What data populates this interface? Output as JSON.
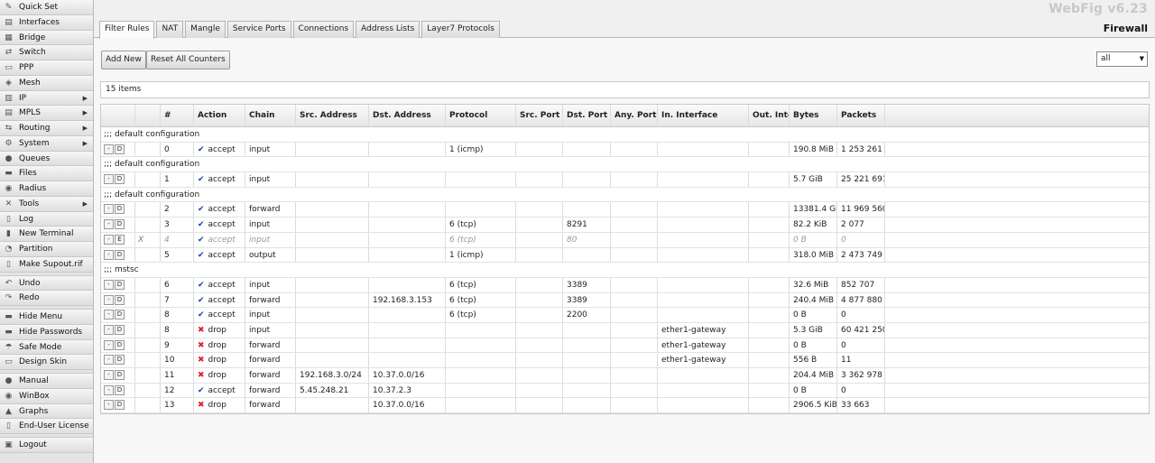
{
  "brand": "WebFig v6.23",
  "page_title": "Firewall",
  "sidebar": {
    "items": [
      {
        "label": "Quick Set",
        "icon": "wand-icon",
        "glyph": "✎",
        "arrow": false
      },
      {
        "label": "Interfaces",
        "icon": "interfaces-icon",
        "glyph": "▤",
        "arrow": false
      },
      {
        "label": "Bridge",
        "icon": "bridge-icon",
        "glyph": "▦",
        "arrow": false
      },
      {
        "label": "Switch",
        "icon": "switch-icon",
        "glyph": "⇄",
        "arrow": false
      },
      {
        "label": "PPP",
        "icon": "ppp-icon",
        "glyph": "▭",
        "arrow": false
      },
      {
        "label": "Mesh",
        "icon": "mesh-icon",
        "glyph": "◈",
        "arrow": false
      },
      {
        "label": "IP",
        "icon": "ip-icon",
        "glyph": "▥",
        "arrow": true
      },
      {
        "label": "MPLS",
        "icon": "mpls-icon",
        "glyph": "▤",
        "arrow": true
      },
      {
        "label": "Routing",
        "icon": "routing-icon",
        "glyph": "⇆",
        "arrow": true
      },
      {
        "label": "System",
        "icon": "system-gear-icon",
        "glyph": "⚙",
        "arrow": true
      },
      {
        "label": "Queues",
        "icon": "queues-icon",
        "glyph": "●",
        "arrow": false
      },
      {
        "label": "Files",
        "icon": "files-icon",
        "glyph": "▬",
        "arrow": false
      },
      {
        "label": "Radius",
        "icon": "radius-icon",
        "glyph": "◉",
        "arrow": false
      },
      {
        "label": "Tools",
        "icon": "tools-icon",
        "glyph": "✕",
        "arrow": true
      },
      {
        "label": "Log",
        "icon": "log-icon",
        "glyph": "▯",
        "arrow": false
      },
      {
        "label": "New Terminal",
        "icon": "terminal-icon",
        "glyph": "▮",
        "arrow": false
      },
      {
        "label": "Partition",
        "icon": "partition-icon",
        "glyph": "◔",
        "arrow": false
      },
      {
        "label": "Make Supout.rif",
        "icon": "supout-icon",
        "glyph": "▯",
        "arrow": false
      }
    ],
    "actions": [
      {
        "label": "Undo",
        "icon": "undo-icon",
        "glyph": "↶"
      },
      {
        "label": "Redo",
        "icon": "redo-icon",
        "glyph": "↷"
      }
    ],
    "view": [
      {
        "label": "Hide Menu",
        "icon": "hide-menu-icon",
        "glyph": "▬"
      },
      {
        "label": "Hide Passwords",
        "icon": "hide-passwords-icon",
        "glyph": "▬"
      },
      {
        "label": "Safe Mode",
        "icon": "umbrella-icon",
        "glyph": "☂"
      },
      {
        "label": "Design Skin",
        "icon": "design-skin-icon",
        "glyph": "▭"
      }
    ],
    "links": [
      {
        "label": "Manual",
        "icon": "manual-icon",
        "glyph": "●"
      },
      {
        "label": "WinBox",
        "icon": "winbox-icon",
        "glyph": "◉"
      },
      {
        "label": "Graphs",
        "icon": "graphs-icon",
        "glyph": "▲"
      },
      {
        "label": "End-User License",
        "icon": "license-icon",
        "glyph": "▯"
      }
    ],
    "logout": {
      "label": "Logout",
      "icon": "logout-icon",
      "glyph": "▣"
    }
  },
  "tabs": [
    "Filter Rules",
    "NAT",
    "Mangle",
    "Service Ports",
    "Connections",
    "Address Lists",
    "Layer7 Protocols"
  ],
  "toolbar": {
    "add_new": "Add New",
    "reset_counters": "Reset All Counters"
  },
  "filter": {
    "selected": "all"
  },
  "item_count": "15 items",
  "table": {
    "columns": [
      "",
      "",
      "#",
      "Action",
      "Chain",
      "Src. Address",
      "Dst. Address",
      "Protocol",
      "Src. Port",
      "Dst. Port",
      "Any. Port",
      "In. Interface",
      "Out. Interf...",
      "Bytes",
      "Packets"
    ],
    "rows": [
      {
        "kind": "comment",
        "text": ";;; default configuration"
      },
      {
        "kind": "rule",
        "toggle": "D",
        "flag": "",
        "num": "0",
        "action": "accept",
        "chain": "input",
        "src": "",
        "dst": "",
        "proto": "1 (icmp)",
        "sport": "",
        "dport": "",
        "aport": "",
        "iin": "",
        "iout": "",
        "bytes": "190.8 MiB",
        "packets": "1 253 261"
      },
      {
        "kind": "comment",
        "text": ";;; default configuration"
      },
      {
        "kind": "rule",
        "toggle": "D",
        "flag": "",
        "num": "1",
        "action": "accept",
        "chain": "input",
        "src": "",
        "dst": "",
        "proto": "",
        "sport": "",
        "dport": "",
        "aport": "",
        "iin": "",
        "iout": "",
        "bytes": "5.7 GiB",
        "packets": "25 221 691"
      },
      {
        "kind": "comment",
        "text": ";;; default configuration"
      },
      {
        "kind": "rule",
        "toggle": "D",
        "flag": "",
        "num": "2",
        "action": "accept",
        "chain": "forward",
        "src": "",
        "dst": "",
        "proto": "",
        "sport": "",
        "dport": "",
        "aport": "",
        "iin": "",
        "iout": "",
        "bytes": "13381.4 GiB",
        "packets": "11 969 560"
      },
      {
        "kind": "rule",
        "toggle": "D",
        "flag": "",
        "num": "3",
        "action": "accept",
        "chain": "input",
        "src": "",
        "dst": "",
        "proto": "6 (tcp)",
        "sport": "",
        "dport": "8291",
        "aport": "",
        "iin": "",
        "iout": "",
        "bytes": "82.2 KiB",
        "packets": "2 077"
      },
      {
        "kind": "rule",
        "disabled": true,
        "toggle": "E",
        "flag": "X",
        "num": "4",
        "action": "accept",
        "chain": "input",
        "src": "",
        "dst": "",
        "proto": "6 (tcp)",
        "sport": "",
        "dport": "80",
        "aport": "",
        "iin": "",
        "iout": "",
        "bytes": "0 B",
        "packets": "0"
      },
      {
        "kind": "rule",
        "toggle": "D",
        "flag": "",
        "num": "5",
        "action": "accept",
        "chain": "output",
        "src": "",
        "dst": "",
        "proto": "1 (icmp)",
        "sport": "",
        "dport": "",
        "aport": "",
        "iin": "",
        "iout": "",
        "bytes": "318.0 MiB",
        "packets": "2 473 749"
      },
      {
        "kind": "comment",
        "text": ";;; mstsc"
      },
      {
        "kind": "rule",
        "toggle": "D",
        "flag": "",
        "num": "6",
        "action": "accept",
        "chain": "input",
        "src": "",
        "dst": "",
        "proto": "6 (tcp)",
        "sport": "",
        "dport": "3389",
        "aport": "",
        "iin": "",
        "iout": "",
        "bytes": "32.6 MiB",
        "packets": "852 707"
      },
      {
        "kind": "rule",
        "toggle": "D",
        "flag": "",
        "num": "7",
        "action": "accept",
        "chain": "forward",
        "src": "",
        "dst": "192.168.3.153",
        "proto": "6 (tcp)",
        "sport": "",
        "dport": "3389",
        "aport": "",
        "iin": "",
        "iout": "",
        "bytes": "240.4 MiB",
        "packets": "4 877 880"
      },
      {
        "kind": "rule",
        "toggle": "D",
        "flag": "",
        "num": "8",
        "action": "accept",
        "chain": "input",
        "src": "",
        "dst": "",
        "proto": "6 (tcp)",
        "sport": "",
        "dport": "2200",
        "aport": "",
        "iin": "",
        "iout": "",
        "bytes": "0 B",
        "packets": "0"
      },
      {
        "kind": "rule",
        "toggle": "D",
        "flag": "",
        "num": "8",
        "action": "drop",
        "chain": "input",
        "src": "",
        "dst": "",
        "proto": "",
        "sport": "",
        "dport": "",
        "aport": "",
        "iin": "ether1-gateway",
        "iout": "",
        "bytes": "5.3 GiB",
        "packets": "60 421 250"
      },
      {
        "kind": "rule",
        "toggle": "D",
        "flag": "",
        "num": "9",
        "action": "drop",
        "chain": "forward",
        "src": "",
        "dst": "",
        "proto": "",
        "sport": "",
        "dport": "",
        "aport": "",
        "iin": "ether1-gateway",
        "iout": "",
        "bytes": "0 B",
        "packets": "0"
      },
      {
        "kind": "rule",
        "toggle": "D",
        "flag": "",
        "num": "10",
        "action": "drop",
        "chain": "forward",
        "src": "",
        "dst": "",
        "proto": "",
        "sport": "",
        "dport": "",
        "aport": "",
        "iin": "ether1-gateway",
        "iout": "",
        "bytes": "556 B",
        "packets": "11"
      },
      {
        "kind": "rule",
        "toggle": "D",
        "flag": "",
        "num": "11",
        "action": "drop",
        "chain": "forward",
        "src": "192.168.3.0/24",
        "dst": "10.37.0.0/16",
        "proto": "",
        "sport": "",
        "dport": "",
        "aport": "",
        "iin": "",
        "iout": "",
        "bytes": "204.4 MiB",
        "packets": "3 362 978"
      },
      {
        "kind": "rule",
        "toggle": "D",
        "flag": "",
        "num": "12",
        "action": "accept",
        "chain": "forward",
        "src": "5.45.248.21",
        "dst": "10.37.2.3",
        "proto": "",
        "sport": "",
        "dport": "",
        "aport": "",
        "iin": "",
        "iout": "",
        "bytes": "0 B",
        "packets": "0"
      },
      {
        "kind": "rule",
        "toggle": "D",
        "flag": "",
        "num": "13",
        "action": "drop",
        "chain": "forward",
        "src": "",
        "dst": "10.37.0.0/16",
        "proto": "",
        "sport": "",
        "dport": "",
        "aport": "",
        "iin": "",
        "iout": "",
        "bytes": "2906.5 KiB",
        "packets": "33 663"
      }
    ]
  },
  "colors": {
    "accept": "#1a3fb8",
    "drop": "#dd2222",
    "sidebar_bg": "#e4e4e4"
  }
}
